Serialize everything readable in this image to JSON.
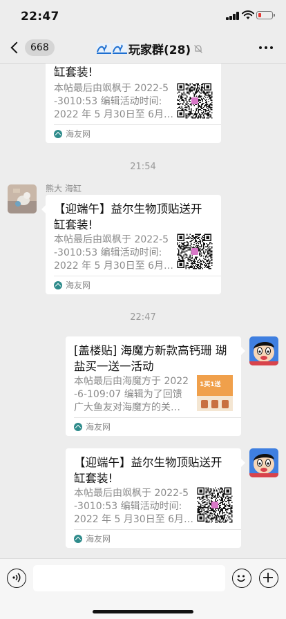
{
  "status_bar": {
    "time": "22:47"
  },
  "nav": {
    "unread_count": "668",
    "title": "玩家群(28)"
  },
  "messages": [
    {
      "title": "缸套装!",
      "desc_line1": "本帖最后由飒枫于 2022-5",
      "desc_line2": "-3010:53 编辑活动时间:",
      "desc_line3": "2022 年 5 月30日至 6月…",
      "source": "海友网"
    },
    {
      "time": "21:54",
      "sender": "熊大 海缸",
      "title_line1": "【迎端午】益尔生物顶贴送开",
      "title_line2": "缸套装!",
      "desc_line1": "本帖最后由飒枫于 2022-5",
      "desc_line2": "-3010:53 编辑活动时间:",
      "desc_line3": "2022 年 5 月30日至 6月…",
      "source": "海友网"
    },
    {
      "time": "22:47",
      "title_line1": "[盖楼贴] 海魔方新款高钙珊 瑚",
      "title_line2": "盐买一送一活动",
      "desc_line1": "本帖最后由海魔方于 2022",
      "desc_line2": "-6-109:07 编辑为了回馈",
      "desc_line3": "广大鱼友对海魔方的关…",
      "thumb_text": "1买1送",
      "source": "海友网"
    },
    {
      "title_line1": "【迎端午】益尔生物顶贴送开",
      "title_line2": "缸套装!",
      "desc_line1": "本帖最后由飒枫于 2022-5",
      "desc_line2": "-3010:53 编辑活动时间:",
      "desc_line3": "2022 年 5 月30日至 6月…",
      "source": "海友网"
    }
  ],
  "input": {
    "value": ""
  },
  "colors": {
    "background": "#ededed",
    "bubble": "#ffffff",
    "source_icon": "#2e8b8b",
    "battery_low": "#e53935"
  }
}
